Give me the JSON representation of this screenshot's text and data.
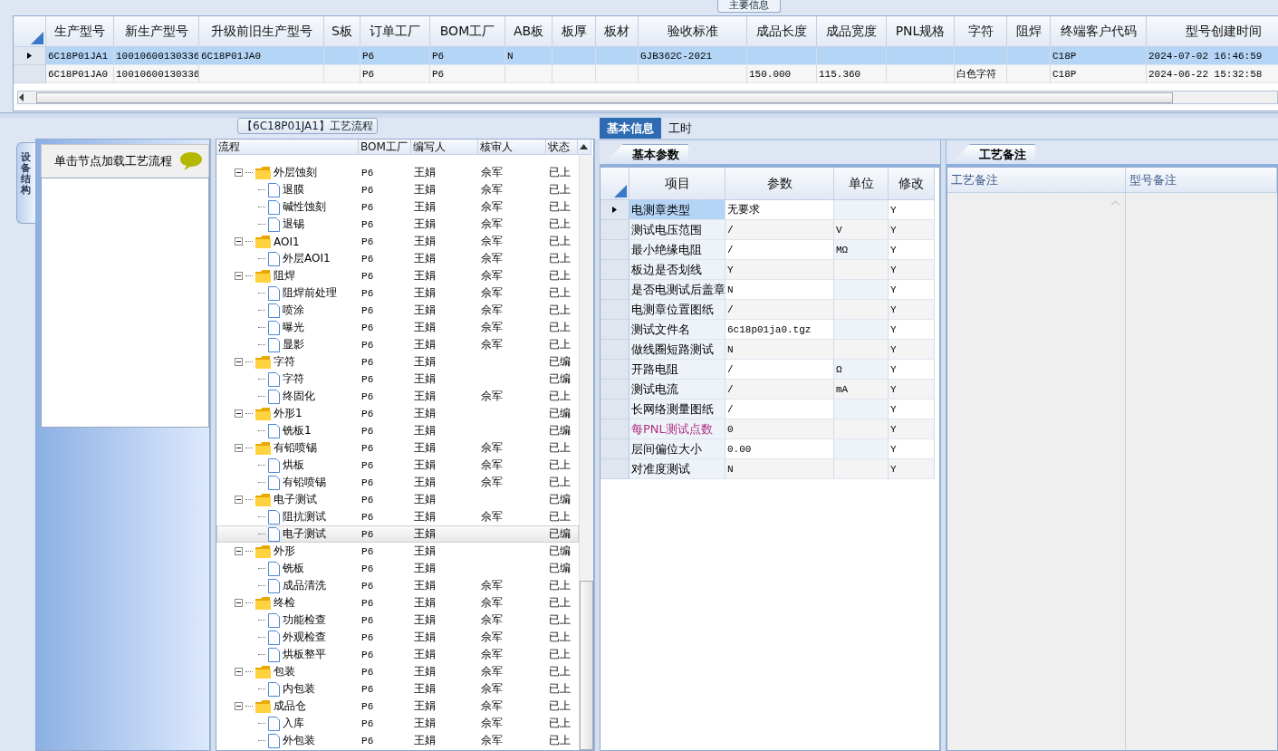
{
  "main_info": {
    "title": "主要信息",
    "columns": [
      "生产型号",
      "新生产型号",
      "升级前旧生产型号",
      "S板",
      "订单工厂",
      "BOM工厂",
      "AB板",
      "板厚",
      "板材",
      "验收标准",
      "成品长度",
      "成品宽度",
      "PNL规格",
      "字符",
      "阻焊",
      "终端客户代码",
      "型号创建时间"
    ],
    "rows": [
      {
        "selected": true,
        "cells": [
          "6C18P01JA1",
          "10010600130336",
          "6C18P01JA0",
          "",
          "P6",
          "P6",
          "N",
          "",
          "",
          "GJB362C-2021",
          "",
          "",
          "",
          "",
          "",
          "C18P",
          "2024-07-02 16:46:59"
        ]
      },
      {
        "selected": false,
        "cells": [
          "6C18P01JA0",
          "10010600130336",
          "",
          "",
          "P6",
          "P6",
          "",
          "",
          "",
          "",
          "150.000",
          "115.360",
          "",
          "白色字符",
          "",
          "C18P",
          "2024-06-22 15:32:58"
        ]
      }
    ]
  },
  "flow_panel": {
    "title": "【6C18P01JA1】工艺流程",
    "side_tab": "设备结构",
    "hint": "单击节点加载工艺流程",
    "columns": [
      "流程",
      "BOM工厂",
      "编写人",
      "核审人",
      "状态"
    ],
    "tree": [
      {
        "name": "外层蚀刻",
        "kind": "folder",
        "expanded": true,
        "selected": false,
        "cells": [
          "P6",
          "王娟",
          "佘军",
          "已上"
        ],
        "children": [
          {
            "name": "退膜",
            "kind": "file",
            "selected": false,
            "cells": [
              "P6",
              "王娟",
              "佘军",
              "已上"
            ]
          },
          {
            "name": "碱性蚀刻",
            "kind": "file",
            "selected": false,
            "cells": [
              "P6",
              "王娟",
              "佘军",
              "已上"
            ]
          },
          {
            "name": "退锡",
            "kind": "file",
            "selected": false,
            "cells": [
              "P6",
              "王娟",
              "佘军",
              "已上"
            ]
          }
        ]
      },
      {
        "name": "AOI1",
        "kind": "folder",
        "expanded": true,
        "selected": false,
        "cells": [
          "P6",
          "王娟",
          "佘军",
          "已上"
        ],
        "children": [
          {
            "name": "外层AOI1",
            "kind": "file",
            "selected": false,
            "cells": [
              "P6",
              "王娟",
              "佘军",
              "已上"
            ]
          }
        ]
      },
      {
        "name": "阻焊",
        "kind": "folder",
        "expanded": true,
        "selected": false,
        "cells": [
          "P6",
          "王娟",
          "佘军",
          "已上"
        ],
        "children": [
          {
            "name": "阻焊前处理",
            "kind": "file",
            "selected": false,
            "cells": [
              "P6",
              "王娟",
              "佘军",
              "已上"
            ]
          },
          {
            "name": "喷涂",
            "kind": "file",
            "selected": false,
            "cells": [
              "P6",
              "王娟",
              "佘军",
              "已上"
            ]
          },
          {
            "name": "曝光",
            "kind": "file",
            "selected": false,
            "cells": [
              "P6",
              "王娟",
              "佘军",
              "已上"
            ]
          },
          {
            "name": "显影",
            "kind": "file",
            "selected": false,
            "cells": [
              "P6",
              "王娟",
              "佘军",
              "已上"
            ]
          }
        ]
      },
      {
        "name": "字符",
        "kind": "folder",
        "expanded": true,
        "selected": false,
        "cells": [
          "P6",
          "王娟",
          "",
          "已编"
        ],
        "children": [
          {
            "name": "字符",
            "kind": "file",
            "selected": false,
            "cells": [
              "P6",
              "王娟",
              "",
              "已编"
            ]
          },
          {
            "name": "终固化",
            "kind": "file",
            "selected": false,
            "cells": [
              "P6",
              "王娟",
              "佘军",
              "已上"
            ]
          }
        ]
      },
      {
        "name": "外形1",
        "kind": "folder",
        "expanded": true,
        "selected": false,
        "cells": [
          "P6",
          "王娟",
          "",
          "已编"
        ],
        "children": [
          {
            "name": "铣板1",
            "kind": "file",
            "selected": false,
            "cells": [
              "P6",
              "王娟",
              "",
              "已编"
            ]
          }
        ]
      },
      {
        "name": "有铅喷锡",
        "kind": "folder",
        "expanded": true,
        "selected": false,
        "cells": [
          "P6",
          "王娟",
          "佘军",
          "已上"
        ],
        "children": [
          {
            "name": "烘板",
            "kind": "file",
            "selected": false,
            "cells": [
              "P6",
              "王娟",
              "佘军",
              "已上"
            ]
          },
          {
            "name": "有铅喷锡",
            "kind": "file",
            "selected": false,
            "cells": [
              "P6",
              "王娟",
              "佘军",
              "已上"
            ]
          }
        ]
      },
      {
        "name": "电子测试",
        "kind": "folder",
        "expanded": true,
        "selected": false,
        "cells": [
          "P6",
          "王娟",
          "",
          "已编"
        ],
        "children": [
          {
            "name": "阻抗测试",
            "kind": "file",
            "selected": false,
            "cells": [
              "P6",
              "王娟",
              "佘军",
              "已上"
            ]
          },
          {
            "name": "电子测试",
            "kind": "file",
            "selected": true,
            "cells": [
              "P6",
              "王娟",
              "",
              "已编"
            ]
          }
        ]
      },
      {
        "name": "外形",
        "kind": "folder",
        "expanded": true,
        "selected": false,
        "cells": [
          "P6",
          "王娟",
          "",
          "已编"
        ],
        "children": [
          {
            "name": "铣板",
            "kind": "file",
            "selected": false,
            "cells": [
              "P6",
              "王娟",
              "",
              "已编"
            ]
          },
          {
            "name": "成品清洗",
            "kind": "file",
            "selected": false,
            "cells": [
              "P6",
              "王娟",
              "佘军",
              "已上"
            ]
          }
        ]
      },
      {
        "name": "终检",
        "kind": "folder",
        "expanded": true,
        "selected": false,
        "cells": [
          "P6",
          "王娟",
          "佘军",
          "已上"
        ],
        "children": [
          {
            "name": "功能检查",
            "kind": "file",
            "selected": false,
            "cells": [
              "P6",
              "王娟",
              "佘军",
              "已上"
            ]
          },
          {
            "name": "外观检查",
            "kind": "file",
            "selected": false,
            "cells": [
              "P6",
              "王娟",
              "佘军",
              "已上"
            ]
          },
          {
            "name": "烘板整平",
            "kind": "file",
            "selected": false,
            "cells": [
              "P6",
              "王娟",
              "佘军",
              "已上"
            ]
          }
        ]
      },
      {
        "name": "包装",
        "kind": "folder",
        "expanded": true,
        "selected": false,
        "cells": [
          "P6",
          "王娟",
          "佘军",
          "已上"
        ],
        "children": [
          {
            "name": "内包装",
            "kind": "file",
            "selected": false,
            "cells": [
              "P6",
              "王娟",
              "佘军",
              "已上"
            ]
          }
        ]
      },
      {
        "name": "成品仓",
        "kind": "folder",
        "expanded": true,
        "selected": false,
        "cells": [
          "P6",
          "王娟",
          "佘军",
          "已上"
        ],
        "children": [
          {
            "name": "入库",
            "kind": "file",
            "selected": false,
            "cells": [
              "P6",
              "王娟",
              "佘军",
              "已上"
            ]
          },
          {
            "name": "外包装",
            "kind": "file",
            "selected": false,
            "cells": [
              "P6",
              "王娟",
              "佘军",
              "已上"
            ]
          }
        ]
      }
    ]
  },
  "detail_tabs": [
    {
      "label": "基本信息",
      "selected": true
    },
    {
      "label": "工时",
      "selected": false
    }
  ],
  "params": {
    "title": "基本参数",
    "columns": [
      "项目",
      "参数",
      "单位",
      "修改"
    ],
    "rows": [
      {
        "item": "电测章类型",
        "value": "无要求",
        "unit": "",
        "modify": "Y",
        "selected": true,
        "flagged": false
      },
      {
        "item": "测试电压范围",
        "value": "/",
        "unit": "V",
        "modify": "Y",
        "selected": false,
        "flagged": false
      },
      {
        "item": "最小绝缘电阻",
        "value": "/",
        "unit": "MΩ",
        "modify": "Y",
        "selected": false,
        "flagged": false
      },
      {
        "item": "板边是否划线",
        "value": "Y",
        "unit": "",
        "modify": "Y",
        "selected": false,
        "flagged": false
      },
      {
        "item": "是否电测试后盖章",
        "value": "N",
        "unit": "",
        "modify": "Y",
        "selected": false,
        "flagged": false
      },
      {
        "item": "电测章位置图纸",
        "value": "/",
        "unit": "",
        "modify": "Y",
        "selected": false,
        "flagged": false
      },
      {
        "item": "测试文件名",
        "value": "6c18p01ja0.tgz",
        "unit": "",
        "modify": "Y",
        "selected": false,
        "flagged": false
      },
      {
        "item": "做线圈短路测试",
        "value": "N",
        "unit": "",
        "modify": "Y",
        "selected": false,
        "flagged": false
      },
      {
        "item": "开路电阻",
        "value": "/",
        "unit": "Ω",
        "modify": "Y",
        "selected": false,
        "flagged": false
      },
      {
        "item": "测试电流",
        "value": "/",
        "unit": "mA",
        "modify": "Y",
        "selected": false,
        "flagged": false
      },
      {
        "item": "长网络测量图纸",
        "value": "/",
        "unit": "",
        "modify": "Y",
        "selected": false,
        "flagged": false
      },
      {
        "item": "每PNL测试点数",
        "value": "0",
        "unit": "",
        "modify": "Y",
        "selected": false,
        "flagged": true
      },
      {
        "item": "层间偏位大小",
        "value": "0.00",
        "unit": "",
        "modify": "Y",
        "selected": false,
        "flagged": false
      },
      {
        "item": "对准度测试",
        "value": "N",
        "unit": "",
        "modify": "Y",
        "selected": false,
        "flagged": false
      }
    ]
  },
  "notes": {
    "title": "工艺备注",
    "columns": [
      "工艺备注",
      "型号备注"
    ]
  }
}
